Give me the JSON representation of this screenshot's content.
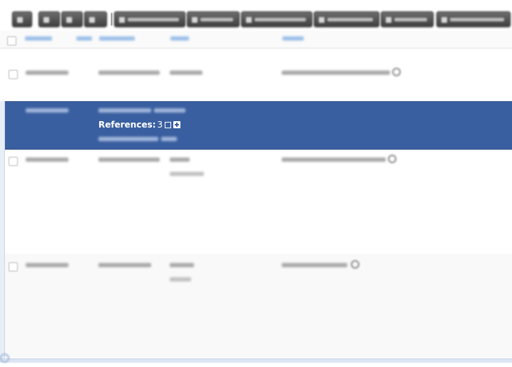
{
  "toolbar": {
    "buttons": [
      {
        "name": "expand-button",
        "icon": "plus-icon"
      },
      {
        "name": "edit-button",
        "icon": "pencil-icon"
      },
      {
        "name": "copy-button",
        "icon": "copy-icon"
      },
      {
        "name": "delete-button",
        "icon": "trash-icon"
      },
      {
        "name": "enable-disable-button",
        "icon": "toggle-icon"
      },
      {
        "name": "attribute-button",
        "icon": "attribute-icon"
      },
      {
        "name": "proposals-button",
        "icon": "proposal-icon"
      },
      {
        "name": "sighting-button",
        "icon": "eye-icon"
      },
      {
        "name": "correlation-button",
        "icon": "link-icon"
      },
      {
        "name": "filter-button",
        "icon": "filter-icon"
      }
    ],
    "button_color": "#4f4f4f"
  },
  "table": {
    "header_color": "#9cc0e8",
    "selected_row_color": "#3a5fa0",
    "references_row": {
      "label": "References:",
      "count": "3",
      "expand_icon": "expand-icon",
      "add_icon": "plus-square-icon"
    }
  }
}
